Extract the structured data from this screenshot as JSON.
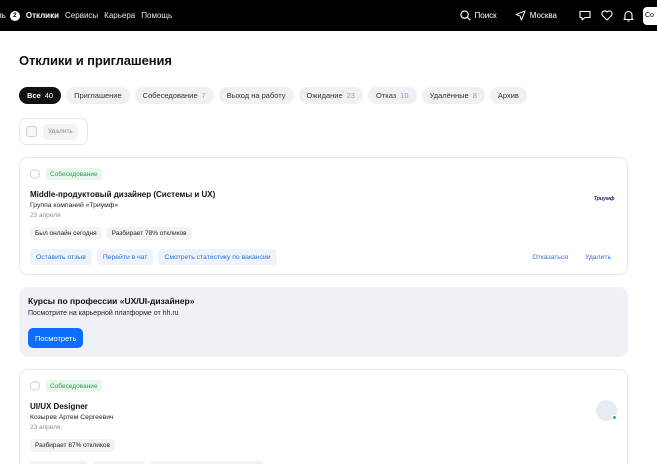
{
  "topbar": {
    "cut_label": "ль",
    "badge": "2",
    "nav": [
      {
        "label": "Отклики",
        "active": true
      },
      {
        "label": "Сервисы",
        "active": false
      },
      {
        "label": "Карьера",
        "active": false
      },
      {
        "label": "Помощь",
        "active": false
      }
    ],
    "search_label": "Поиск",
    "region_label": "Москва",
    "login_label": "Со"
  },
  "page": {
    "title": "Отклики и приглашения"
  },
  "filters": [
    {
      "label": "Все",
      "count": "40",
      "active": true
    },
    {
      "label": "Приглашение",
      "count": "",
      "active": false
    },
    {
      "label": "Собеседование",
      "count": "7",
      "active": false
    },
    {
      "label": "Выход на работу",
      "count": "",
      "active": false
    },
    {
      "label": "Ожидание",
      "count": "23",
      "active": false
    },
    {
      "label": "Отказ",
      "count": "10",
      "active": false
    },
    {
      "label": "Удалённые",
      "count": "8",
      "active": false
    },
    {
      "label": "Архив",
      "count": "",
      "active": false
    }
  ],
  "bulk": {
    "delete_label": "Удалить"
  },
  "responses": [
    {
      "status": "Собеседование",
      "title": "Middle-продуктовый дизайнер (Системы и UX)",
      "company": "Группа компаний «Триумф»",
      "date": "23 апреля",
      "tags": [
        "Был онлайн сегодня",
        "Разбирает 78% откликов"
      ],
      "actions": [
        "Оставить отзыв",
        "Перейти в чат",
        "Смотреть статистику по вакансии"
      ],
      "actions_right": [
        "Отказаться",
        "Удалить"
      ],
      "logo_text": "Триумф"
    },
    {
      "status": "Собеседование",
      "title": "UI/UX Designer",
      "company": "Козырев Артем Сергеевич",
      "date": "23 апреля",
      "tags": [
        "Разбирает 87% откликов"
      ]
    }
  ],
  "promo": {
    "title": "Курсы по профессии «UX/UI-дизайнер»",
    "subtitle": "Посмотрите на карьерной платформе от hh.ru",
    "button": "Посмотреть"
  },
  "colors": {
    "topbar_bg": "#000000",
    "accent_blue": "#0d6efd",
    "status_green": "#2f9b48"
  }
}
